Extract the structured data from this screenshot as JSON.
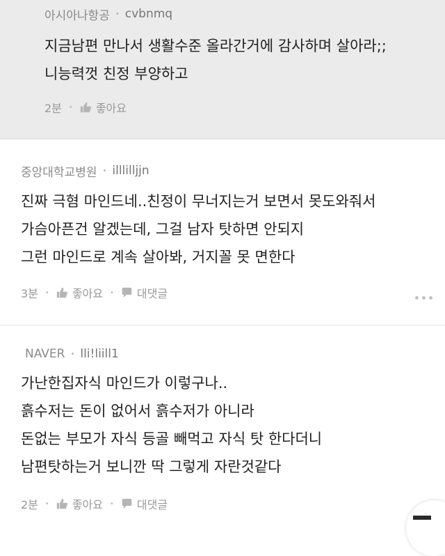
{
  "comments": [
    {
      "source": "아시아나항공",
      "username": "cvbnmq",
      "lines": [
        "지금남편 만나서 생활수준 올라간거에 감사하며 살아라;;",
        "니능력껏 친정 부양하고"
      ],
      "time": "2분",
      "like_label": "좋아요"
    },
    {
      "source": "중앙대학교병원",
      "username": "illlilljjn",
      "lines": [
        "진짜 극혐 마인드네..친정이 무너지는거 보면서 못도와줘서",
        "가슴아픈건 알겠는데, 그걸 남자 탓하면 안되지",
        "그런 마인드로 계속 살아봐, 거지꼴 못 면한다"
      ],
      "time": "3분",
      "like_label": "좋아요",
      "reply_label": "대댓글"
    },
    {
      "source": "NAVER",
      "username": "lli!liill1",
      "lines": [
        "가난한집자식 마인드가 이렇구나..",
        "흙수저는 돈이 없어서 흙수저가 아니라",
        "돈없는 부모가 자식 등골 빼먹고 자식 탓 한다더니",
        "남편탓하는거 보니깐 딱 그렇게 자란것같다"
      ],
      "time": "2분",
      "like_label": "좋아요",
      "reply_label": "대댓글"
    }
  ],
  "meta_separator": "•"
}
